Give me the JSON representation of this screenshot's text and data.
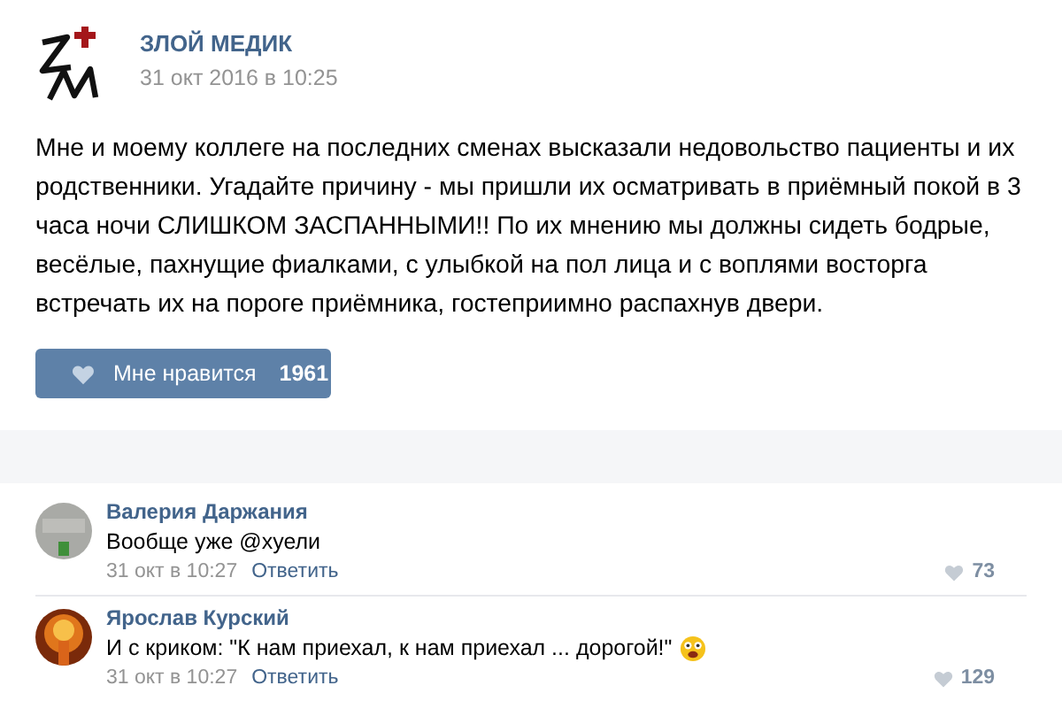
{
  "post": {
    "author": "ЗЛОЙ МЕДИК",
    "date": "31 окт 2016 в 10:25",
    "text": "Мне и моему коллеге на последних сменах высказали недовольство пациенты и их родственники. Угадайте причину - мы пришли их осматривать в приёмный покой в 3 часа ночи СЛИШКОМ ЗАСПАННЫМИ!! По их мнению мы должны сидеть бодрые, весёлые, пахнущие фиалками, с улыбкой на пол лица и с воплями восторга встречать их на пороге приёмника, гостеприимно распахнув двери.",
    "like_button": {
      "label": "Мне нравится",
      "count": "1961"
    }
  },
  "comments": [
    {
      "author": "Валерия Даржания",
      "text": "Вообще уже @хуели",
      "emoji": false,
      "date": "31 окт в 10:27",
      "reply": "Ответить",
      "likes": "73"
    },
    {
      "author": "Ярослав Курский",
      "text": "И с криком: \"К нам приехал, к нам приехал ... дорогой!\"",
      "emoji": true,
      "date": "31 окт в 10:27",
      "reply": "Ответить",
      "likes": "129"
    }
  ]
}
